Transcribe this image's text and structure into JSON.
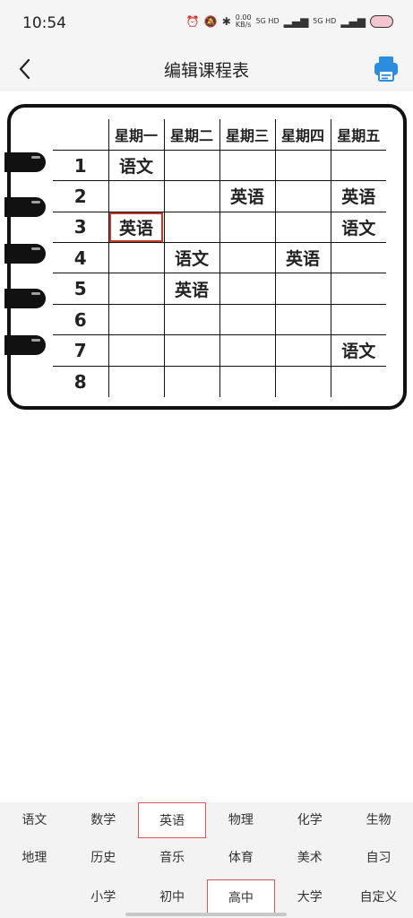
{
  "status": {
    "time": "10:54",
    "speed": "0.00",
    "speed_unit": "KB/s",
    "net1": "5G HD",
    "net2": "5G HD"
  },
  "header": {
    "title": "编辑课程表",
    "back_icon": "chevron-left-icon",
    "print_icon": "printer-icon",
    "print_color": "#2a8de0"
  },
  "schedule": {
    "days": [
      "星期一",
      "星期二",
      "星期三",
      "星期四",
      "星期五"
    ],
    "periods": [
      "1",
      "2",
      "3",
      "4",
      "5",
      "6",
      "7",
      "8"
    ],
    "cells": [
      [
        "语文",
        "",
        "",
        "",
        ""
      ],
      [
        "",
        "",
        "英语",
        "",
        "英语"
      ],
      [
        "英语",
        "",
        "",
        "",
        "语文"
      ],
      [
        "",
        "语文",
        "",
        "英语",
        ""
      ],
      [
        "",
        "英语",
        "",
        "",
        ""
      ],
      [
        "",
        "",
        "",
        "",
        ""
      ],
      [
        "",
        "",
        "",
        "",
        "语文"
      ],
      [
        "",
        "",
        "",
        "",
        ""
      ]
    ],
    "selected_cell": "3-1"
  },
  "subjects": {
    "row1": [
      "语文",
      "数学",
      "英语",
      "物理",
      "化学",
      "生物"
    ],
    "row2": [
      "地理",
      "历史",
      "音乐",
      "体育",
      "美术",
      "自习"
    ],
    "selected": "英语"
  },
  "levels": {
    "items": [
      "小学",
      "初中",
      "高中",
      "大学",
      "自定义"
    ],
    "selected": "高中"
  },
  "colors": {
    "selected_border": "#e05555",
    "cell_highlight": "#c0392b"
  }
}
